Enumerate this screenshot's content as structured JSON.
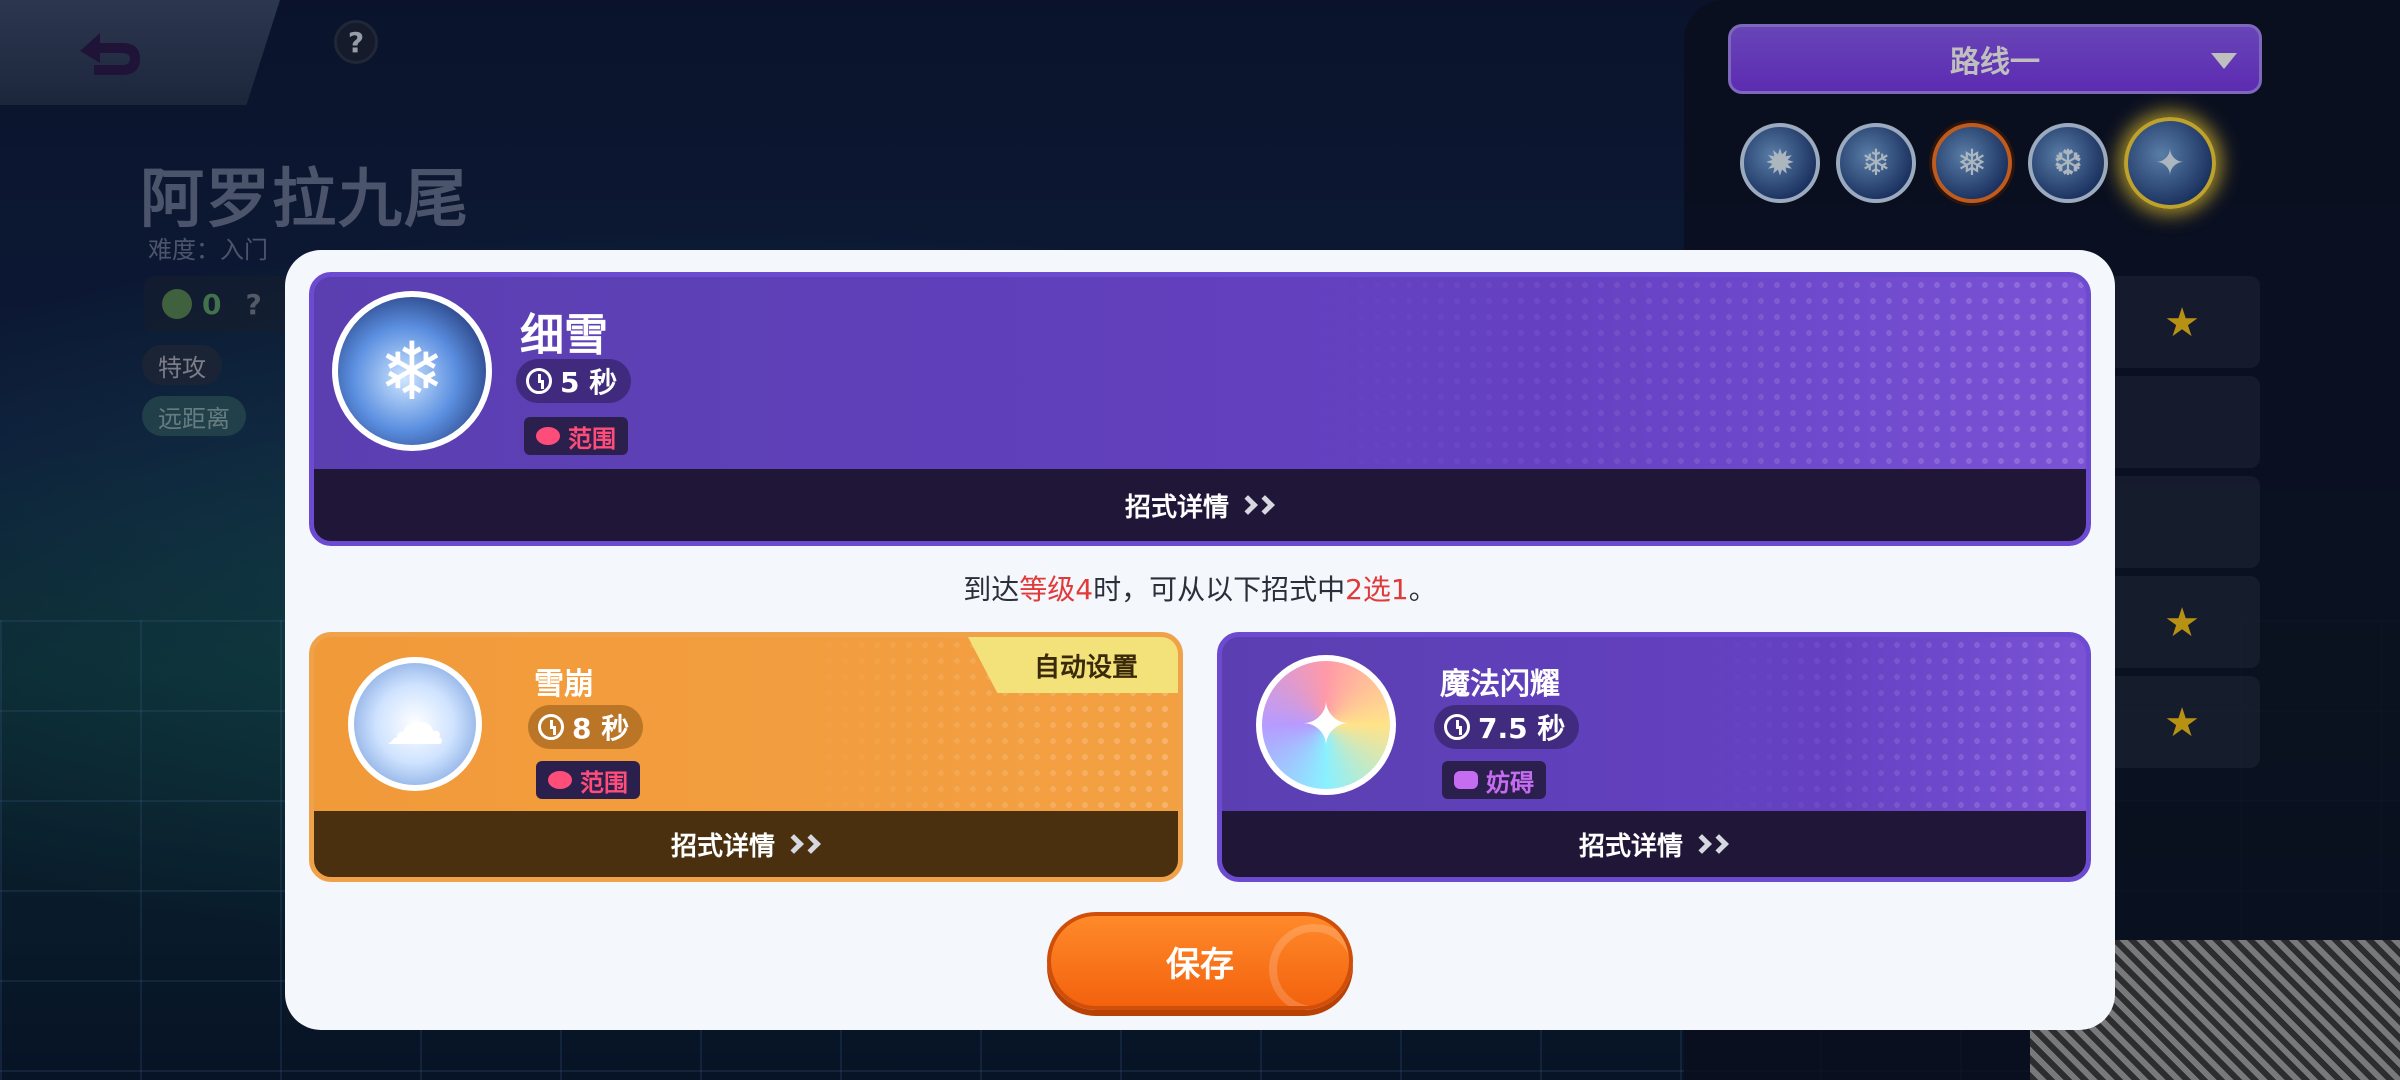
{
  "background": {
    "pokemon_name": "阿罗拉九尾",
    "difficulty": "难度：入门",
    "stat_value": "0",
    "help_glyph": "?",
    "tags": [
      "特攻",
      "远距离"
    ]
  },
  "route": {
    "selected": "路线一"
  },
  "move_icons": [
    "passive",
    "attack",
    "move-1",
    "move-2",
    "unite"
  ],
  "main_move": {
    "name": "细雪",
    "cooldown": "5 秒",
    "type_label": "范围",
    "detail_label": "招式详情"
  },
  "hint": {
    "prefix": "到达",
    "level_text": "等级4",
    "mid": "时，可从以下招式中",
    "choice_text": "2选1",
    "suffix": "。"
  },
  "options": [
    {
      "name": "雪崩",
      "cooldown": "8 秒",
      "type_label": "范围",
      "detail_label": "招式详情",
      "badge": "自动设置"
    },
    {
      "name": "魔法闪耀",
      "cooldown": "7.5 秒",
      "type_label": "妨碍",
      "detail_label": "招式详情"
    }
  ],
  "save_label": "保存",
  "colors": {
    "accent_purple": "#6541c2",
    "accent_orange": "#f3620e",
    "highlight_red": "#e03a3a",
    "area_type": "#ff4d7a",
    "hindrance_type": "#c56cf0"
  }
}
